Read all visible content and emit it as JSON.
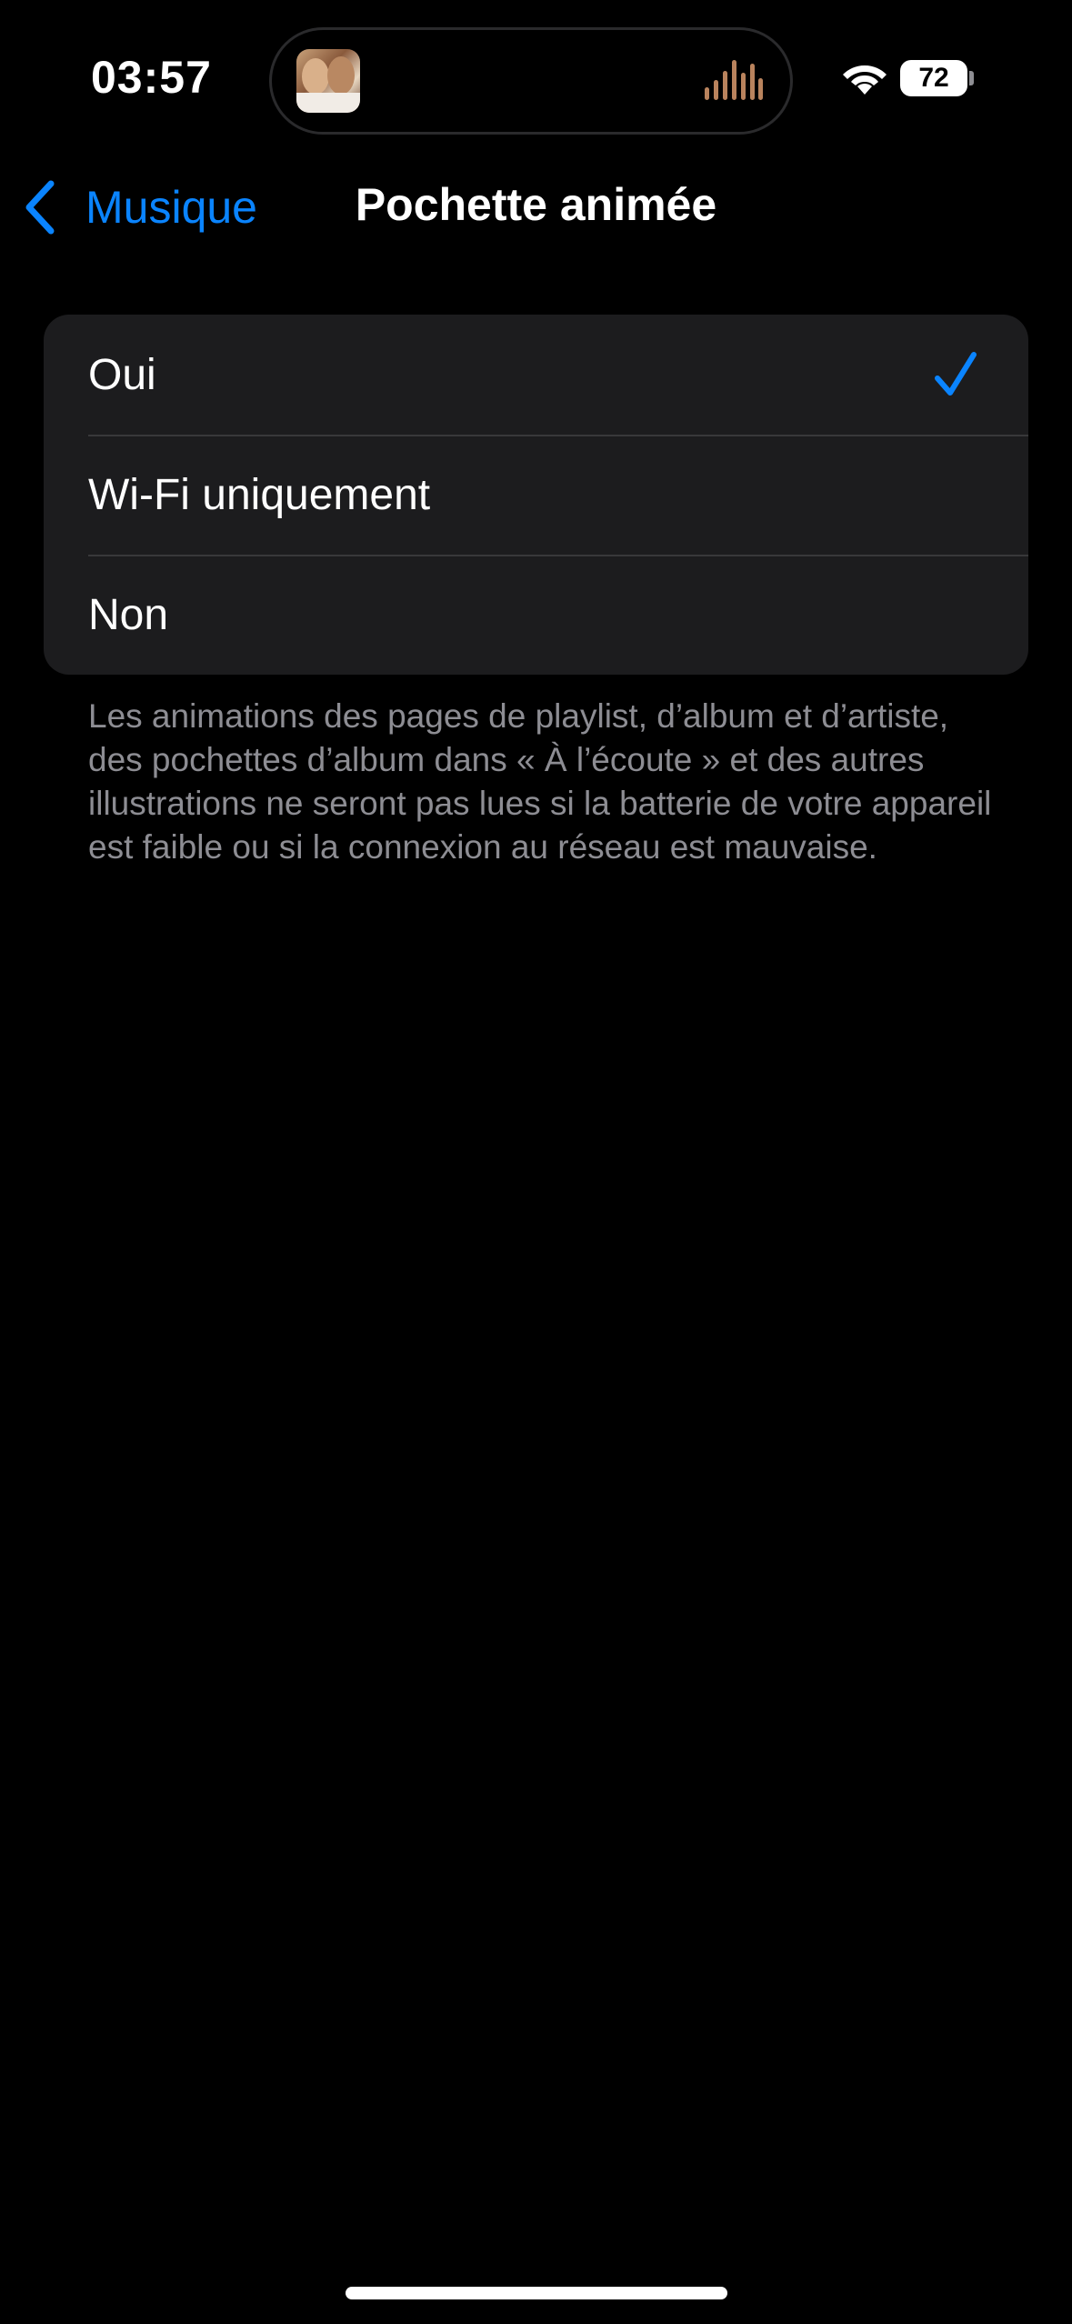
{
  "status_bar": {
    "time": "03:57",
    "battery": "72",
    "wifi_icon": "wifi-icon",
    "now_playing_icon": "waveform-icon"
  },
  "nav": {
    "back_label": "Musique",
    "title": "Pochette animée"
  },
  "options": [
    {
      "label": "Oui",
      "selected": true
    },
    {
      "label": "Wi-Fi uniquement",
      "selected": false
    },
    {
      "label": "Non",
      "selected": false
    }
  ],
  "footer_text": "Les animations des pages de playlist, d’album et d’artiste, des pochettes d’album dans « À l’écoute » et des autres illustrations ne seront pas lues si la batterie de votre appareil est faible ou si la connexion au réseau est mauvaise.",
  "colors": {
    "accent": "#0a84ff",
    "background": "#000000",
    "group_background": "#1c1c1e",
    "secondary_text": "#8d8d93"
  }
}
